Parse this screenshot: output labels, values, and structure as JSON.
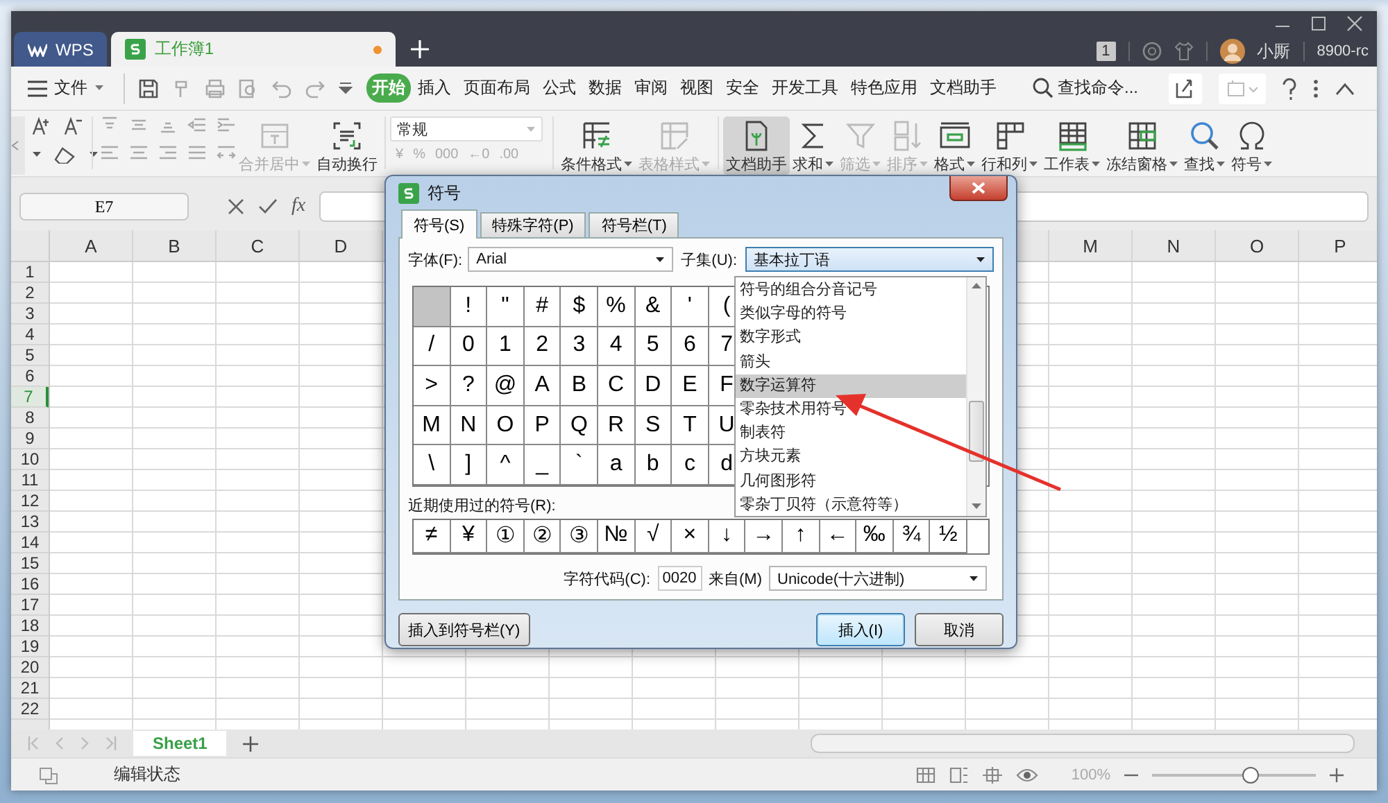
{
  "titlebar": {
    "tabs": [
      {
        "label": "WPS",
        "kind": "home",
        "selected": false,
        "unsaved": false
      },
      {
        "label": "工作簿1",
        "kind": "doc",
        "selected": true,
        "unsaved": true
      }
    ],
    "badge": "1",
    "user": "小厮",
    "account": "8900-rc"
  },
  "menu": {
    "file": "文件",
    "tabs": [
      {
        "label": "开始",
        "selected": true
      },
      {
        "label": "插入",
        "selected": false
      },
      {
        "label": "页面布局",
        "selected": false
      },
      {
        "label": "公式",
        "selected": false
      },
      {
        "label": "数据",
        "selected": false
      },
      {
        "label": "审阅",
        "selected": false
      },
      {
        "label": "视图",
        "selected": false
      },
      {
        "label": "安全",
        "selected": false
      },
      {
        "label": "开发工具",
        "selected": false
      },
      {
        "label": "特色应用",
        "selected": false
      },
      {
        "label": "文档助手",
        "selected": false
      }
    ],
    "search": "查找命令..."
  },
  "ribbon": {
    "left": [
      {
        "label": "合并居中",
        "kind": "merge",
        "disabled": true,
        "dropdown": true,
        "selected": false
      },
      {
        "label": "自动换行",
        "kind": "wrap",
        "disabled": false,
        "dropdown": false,
        "selected": false
      }
    ],
    "number_format": "常规",
    "number_buttons": [
      "¥",
      "%",
      "000",
      "←0",
      ".00"
    ],
    "right": [
      {
        "label": "条件格式",
        "kind": "cond",
        "disabled": false,
        "dropdown": true,
        "selected": false
      },
      {
        "label": "表格样式",
        "kind": "style",
        "disabled": true,
        "dropdown": true,
        "selected": false
      },
      {
        "label": "文档助手",
        "kind": "doc",
        "disabled": false,
        "dropdown": false,
        "selected": true
      },
      {
        "label": "求和",
        "kind": "sum",
        "disabled": false,
        "dropdown": true,
        "selected": false
      },
      {
        "label": "筛选",
        "kind": "filter",
        "disabled": true,
        "dropdown": true,
        "selected": false
      },
      {
        "label": "排序",
        "kind": "sort",
        "disabled": true,
        "dropdown": true,
        "selected": false
      },
      {
        "label": "格式",
        "kind": "format",
        "disabled": false,
        "dropdown": true,
        "selected": false
      },
      {
        "label": "行和列",
        "kind": "rowcol",
        "disabled": false,
        "dropdown": true,
        "selected": false
      },
      {
        "label": "工作表",
        "kind": "sheet",
        "disabled": false,
        "dropdown": true,
        "selected": false
      },
      {
        "label": "冻结窗格",
        "kind": "freeze",
        "disabled": false,
        "dropdown": true,
        "selected": false
      },
      {
        "label": "查找",
        "kind": "find",
        "disabled": false,
        "dropdown": true,
        "selected": false
      },
      {
        "label": "符号",
        "kind": "symbol",
        "disabled": false,
        "dropdown": true,
        "selected": false
      }
    ]
  },
  "formula_bar": {
    "cell": "E7",
    "function_label": "fx"
  },
  "sheet": {
    "columns_left": [
      "A",
      "B",
      "C",
      "D"
    ],
    "columns_right": [
      "M",
      "N",
      "O",
      "P"
    ],
    "rows": [
      {
        "label": "1",
        "selected": false
      },
      {
        "label": "2",
        "selected": false
      },
      {
        "label": "3",
        "selected": false
      },
      {
        "label": "4",
        "selected": false
      },
      {
        "label": "5",
        "selected": false
      },
      {
        "label": "6",
        "selected": false
      },
      {
        "label": "7",
        "selected": true
      },
      {
        "label": "8",
        "selected": false
      },
      {
        "label": "9",
        "selected": false
      },
      {
        "label": "10",
        "selected": false
      },
      {
        "label": "11",
        "selected": false
      },
      {
        "label": "12",
        "selected": false
      },
      {
        "label": "13",
        "selected": false
      },
      {
        "label": "14",
        "selected": false
      },
      {
        "label": "15",
        "selected": false
      },
      {
        "label": "16",
        "selected": false
      },
      {
        "label": "17",
        "selected": false
      },
      {
        "label": "18",
        "selected": false
      },
      {
        "label": "19",
        "selected": false
      },
      {
        "label": "20",
        "selected": false
      },
      {
        "label": "21",
        "selected": false
      },
      {
        "label": "22",
        "selected": false
      }
    ]
  },
  "sheet_tabs": [
    {
      "label": "Sheet1",
      "selected": true
    }
  ],
  "status_bar": {
    "mode": "编辑状态",
    "zoom": "100%",
    "zoom_slider": {
      "level": 0.6
    }
  },
  "dialog": {
    "title": "符号",
    "tabs": [
      {
        "label": "符号(S)",
        "selected": true
      },
      {
        "label": "特殊字符(P)",
        "selected": false
      },
      {
        "label": "符号栏(T)",
        "selected": false
      }
    ],
    "font_label": "字体(F):",
    "font": "Arial",
    "subset_label": "子集(U):",
    "subset": "基本拉丁语",
    "symbols": [
      [
        {
          "selected": true
        },
        {
          "char": "!",
          "selected": false
        },
        {
          "char": "\"",
          "selected": false
        },
        {
          "char": "#",
          "selected": false
        },
        {
          "char": "$",
          "selected": false
        },
        {
          "char": "%",
          "selected": false
        },
        {
          "char": "&",
          "selected": false
        },
        {
          "char": "'",
          "selected": false
        },
        {
          "char": "(",
          "selected": false
        }
      ],
      [
        {
          "char": "/",
          "selected": false
        },
        {
          "char": "0",
          "selected": false
        },
        {
          "char": "1",
          "selected": false
        },
        {
          "char": "2",
          "selected": false
        },
        {
          "char": "3",
          "selected": false
        },
        {
          "char": "4",
          "selected": false
        },
        {
          "char": "5",
          "selected": false
        },
        {
          "char": "6",
          "selected": false
        },
        {
          "char": "7",
          "selected": false
        }
      ],
      [
        {
          "char": ">",
          "selected": false
        },
        {
          "char": "?",
          "selected": false
        },
        {
          "char": "@",
          "selected": false
        },
        {
          "char": "A",
          "selected": false
        },
        {
          "char": "B",
          "selected": false
        },
        {
          "char": "C",
          "selected": false
        },
        {
          "char": "D",
          "selected": false
        },
        {
          "char": "E",
          "selected": false
        },
        {
          "char": "F",
          "selected": false
        }
      ],
      [
        {
          "char": "M",
          "selected": false
        },
        {
          "char": "N",
          "selected": false
        },
        {
          "char": "O",
          "selected": false
        },
        {
          "char": "P",
          "selected": false
        },
        {
          "char": "Q",
          "selected": false
        },
        {
          "char": "R",
          "selected": false
        },
        {
          "char": "S",
          "selected": false
        },
        {
          "char": "T",
          "selected": false
        },
        {
          "char": "U",
          "selected": false
        }
      ],
      [
        {
          "char": "\\",
          "selected": false
        },
        {
          "char": "]",
          "selected": false
        },
        {
          "char": "^",
          "selected": false
        },
        {
          "char": "_",
          "selected": false
        },
        {
          "char": "`",
          "selected": false
        },
        {
          "char": "a",
          "selected": false
        },
        {
          "char": "b",
          "selected": false
        },
        {
          "char": "c",
          "selected": false
        },
        {
          "char": "d",
          "selected": false
        }
      ]
    ],
    "subset_list": [
      {
        "label": "符号的组合分音记号",
        "selected": false
      },
      {
        "label": "类似字母的符号",
        "selected": false
      },
      {
        "label": "数字形式",
        "selected": false
      },
      {
        "label": "箭头",
        "selected": false
      },
      {
        "label": "数字运算符",
        "selected": true
      },
      {
        "label": "零杂技术用符号",
        "selected": false
      },
      {
        "label": "制表符",
        "selected": false
      },
      {
        "label": "方块元素",
        "selected": false
      },
      {
        "label": "几何图形符",
        "selected": false
      },
      {
        "label": "零杂丁贝符（示意符等）",
        "selected": false
      }
    ],
    "recent_label": "近期使用过的符号(R):",
    "recent": [
      "≠",
      "¥",
      "①",
      "②",
      "③",
      "№",
      "√",
      "×",
      "↓",
      "→",
      "↑",
      "←",
      "‰",
      "¾",
      "½"
    ],
    "code_label": "字符代码(C):",
    "code": "0020",
    "from_label": "来自(M)",
    "from": "Unicode(十六进制)",
    "buttons": [
      {
        "label": "插入到符号栏(Y)",
        "default": false
      },
      {
        "label": "插入(I)",
        "default": true
      },
      {
        "label": "取消",
        "default": false
      }
    ]
  }
}
